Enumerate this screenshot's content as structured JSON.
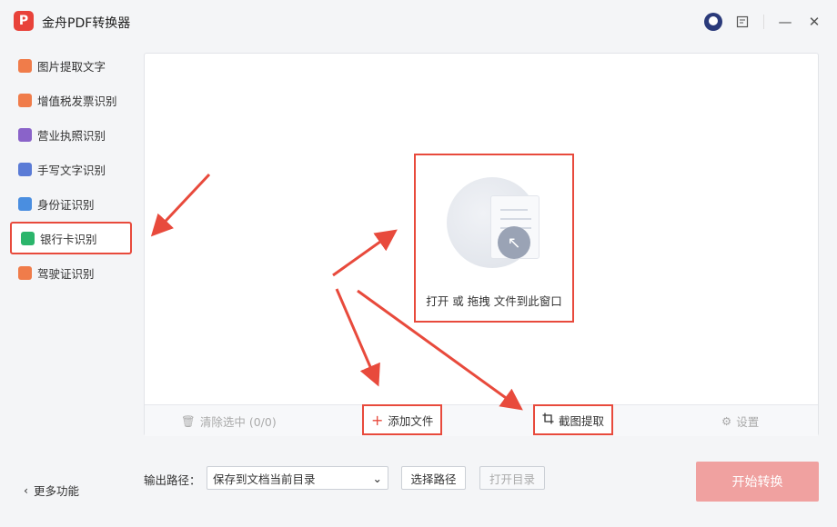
{
  "app": {
    "logo_text": "P",
    "title": "金舟PDF转换器"
  },
  "window": {
    "minimize": "—",
    "close": "✕"
  },
  "sidebar": {
    "items": [
      {
        "label": "图片提取文字",
        "icon": "image-text-icon",
        "color": "#f07c4a"
      },
      {
        "label": "增值税发票识别",
        "icon": "invoice-icon",
        "color": "#f07c4a"
      },
      {
        "label": "营业执照识别",
        "icon": "license-icon",
        "color": "#8a63c9"
      },
      {
        "label": "手写文字识别",
        "icon": "pen-icon",
        "color": "#5a7bd6"
      },
      {
        "label": "身份证识别",
        "icon": "id-card-icon",
        "color": "#4a8ee0"
      },
      {
        "label": "银行卡识别",
        "icon": "bank-card-icon",
        "color": "#2bb56b"
      },
      {
        "label": "驾驶证识别",
        "icon": "car-icon",
        "color": "#f07c4a"
      }
    ],
    "active_index": 5,
    "more_label": "更多功能"
  },
  "dropzone": {
    "text": "打开 或 拖拽 文件到此窗口"
  },
  "toolbar": {
    "clear_label": "清除选中 (0/0)",
    "add_label": "添加文件",
    "crop_label": "截图提取",
    "settings_label": "设置"
  },
  "output": {
    "label": "输出路径：",
    "select_value": "保存到文档当前目录",
    "choose_label": "选择路径",
    "open_label": "打开目录"
  },
  "start_label": "开始转换",
  "colors": {
    "accent": "#e84a3c",
    "start_disabled": "#f0a1a0"
  }
}
